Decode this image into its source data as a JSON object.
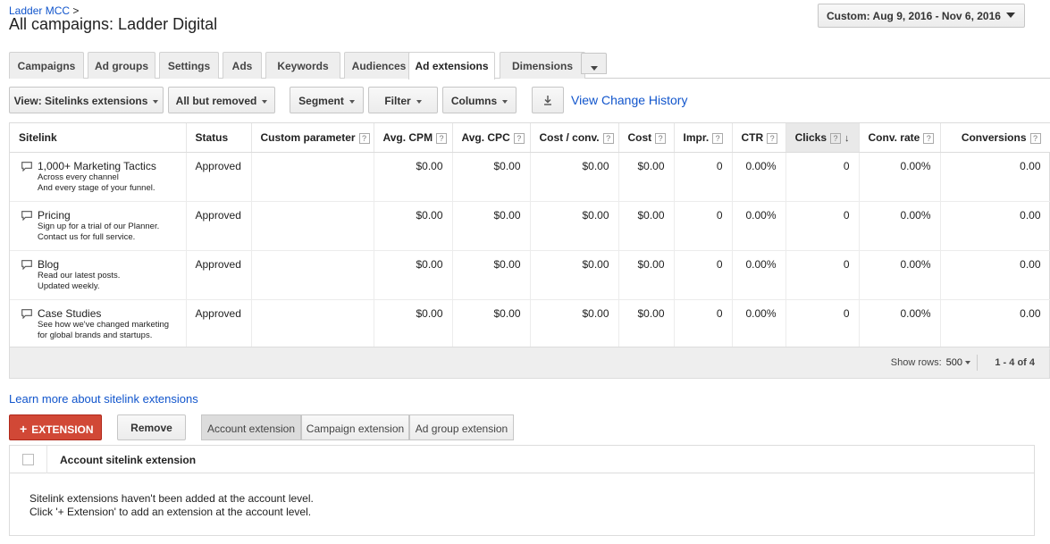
{
  "header": {
    "breadcrumb": "Ladder MCC",
    "breadcrumb_sep": ">",
    "title": "All campaigns: Ladder Digital",
    "date_range": "Custom: Aug 9, 2016 - Nov 6, 2016"
  },
  "tabs": [
    {
      "label": "Campaigns"
    },
    {
      "label": "Ad groups"
    },
    {
      "label": "Settings"
    },
    {
      "label": "Ads"
    },
    {
      "label": "Keywords"
    },
    {
      "label": "Audiences"
    },
    {
      "label": "Ad extensions"
    },
    {
      "label": "Dimensions"
    }
  ],
  "toolbar": {
    "view": "View: Sitelinks extensions",
    "status_filter": "All but removed",
    "segment": "Segment",
    "filter": "Filter",
    "columns": "Columns",
    "view_history": "View Change History"
  },
  "table": {
    "columns": [
      "Sitelink",
      "Status",
      "Custom parameter",
      "Avg. CPM",
      "Avg. CPC",
      "Cost / conv.",
      "Cost",
      "Impr.",
      "CTR",
      "Clicks",
      "Conv. rate",
      "Conversions"
    ],
    "help_mark": "?",
    "sort_arrow": "↓",
    "rows": [
      {
        "name": "1,000+ Marketing Tactics",
        "line1": "Across every channel",
        "line2": "And every stage of your funnel.",
        "status": "Approved",
        "custom": "",
        "cpm": "$0.00",
        "cpc": "$0.00",
        "cost_conv": "$0.00",
        "cost": "$0.00",
        "impr": "0",
        "ctr": "0.00%",
        "clicks": "0",
        "conv_rate": "0.00%",
        "conversions": "0.00"
      },
      {
        "name": "Pricing",
        "line1": "Sign up for a trial of our Planner.",
        "line2": "Contact us for full service.",
        "status": "Approved",
        "custom": "",
        "cpm": "$0.00",
        "cpc": "$0.00",
        "cost_conv": "$0.00",
        "cost": "$0.00",
        "impr": "0",
        "ctr": "0.00%",
        "clicks": "0",
        "conv_rate": "0.00%",
        "conversions": "0.00"
      },
      {
        "name": "Blog",
        "line1": "Read our latest posts.",
        "line2": "Updated weekly.",
        "status": "Approved",
        "custom": "",
        "cpm": "$0.00",
        "cpc": "$0.00",
        "cost_conv": "$0.00",
        "cost": "$0.00",
        "impr": "0",
        "ctr": "0.00%",
        "clicks": "0",
        "conv_rate": "0.00%",
        "conversions": "0.00"
      },
      {
        "name": "Case Studies",
        "line1": "See how we've changed marketing",
        "line2": "for global brands and startups.",
        "status": "Approved",
        "custom": "",
        "cpm": "$0.00",
        "cpc": "$0.00",
        "cost_conv": "$0.00",
        "cost": "$0.00",
        "impr": "0",
        "ctr": "0.00%",
        "clicks": "0",
        "conv_rate": "0.00%",
        "conversions": "0.00"
      }
    ],
    "footer": {
      "show_rows_label": "Show rows:",
      "show_rows_value": "500",
      "page_range": "1 - 4 of 4"
    }
  },
  "learn_more": "Learn more about sitelink extensions",
  "actions": {
    "extension_plus": "+",
    "extension": "EXTENSION",
    "remove": "Remove",
    "segments": [
      "Account extension",
      "Campaign extension",
      "Ad group extension"
    ]
  },
  "account_panel": {
    "header": "Account sitelink extension",
    "message_line1": "Sitelink extensions haven't been added at the account level.",
    "message_line2": "Click '+ Extension' to add an extension at the account level."
  },
  "colors": {
    "link": "#1155cc",
    "extension_button": "#d14836"
  }
}
